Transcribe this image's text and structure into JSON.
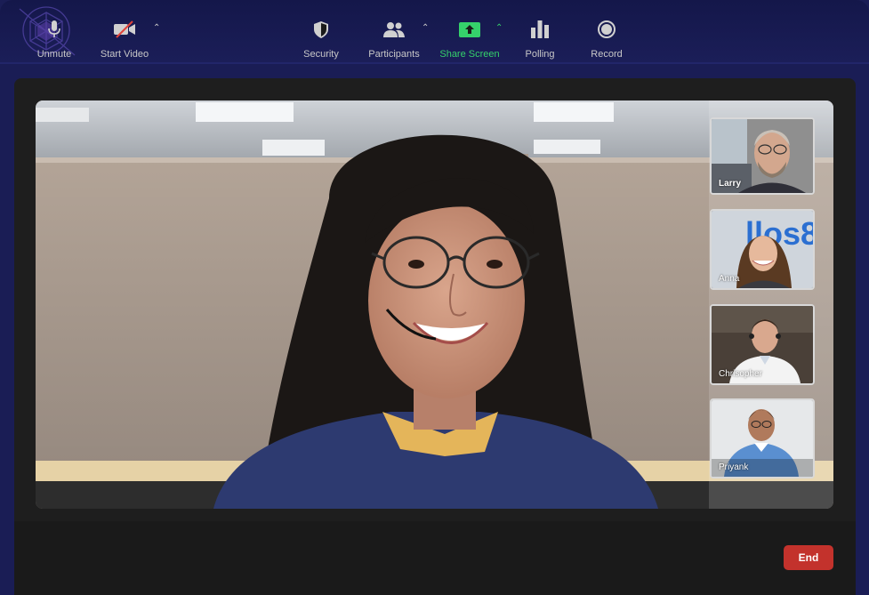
{
  "participants": [
    {
      "name": "Larry"
    },
    {
      "name": "Anna"
    },
    {
      "name": "Chrisopher"
    },
    {
      "name": "Priyank"
    }
  ],
  "toolbar": {
    "unmute": "Unmute",
    "start_video": "Start Video",
    "security": "Security",
    "participants": "Participants",
    "share_screen": "Share Screen",
    "polling": "Polling",
    "record": "Record",
    "end": "End"
  },
  "colors": {
    "background": "#1a1d55",
    "share_screen": "#35d16b",
    "end_button": "#c3322c",
    "toolbar": "#1a1a1a"
  },
  "icons": [
    "app-logo-icon",
    "microphone-icon",
    "video-off-icon",
    "shield-icon",
    "participants-icon",
    "share-screen-icon",
    "polling-icon",
    "record-icon",
    "chevron-up-icon"
  ]
}
